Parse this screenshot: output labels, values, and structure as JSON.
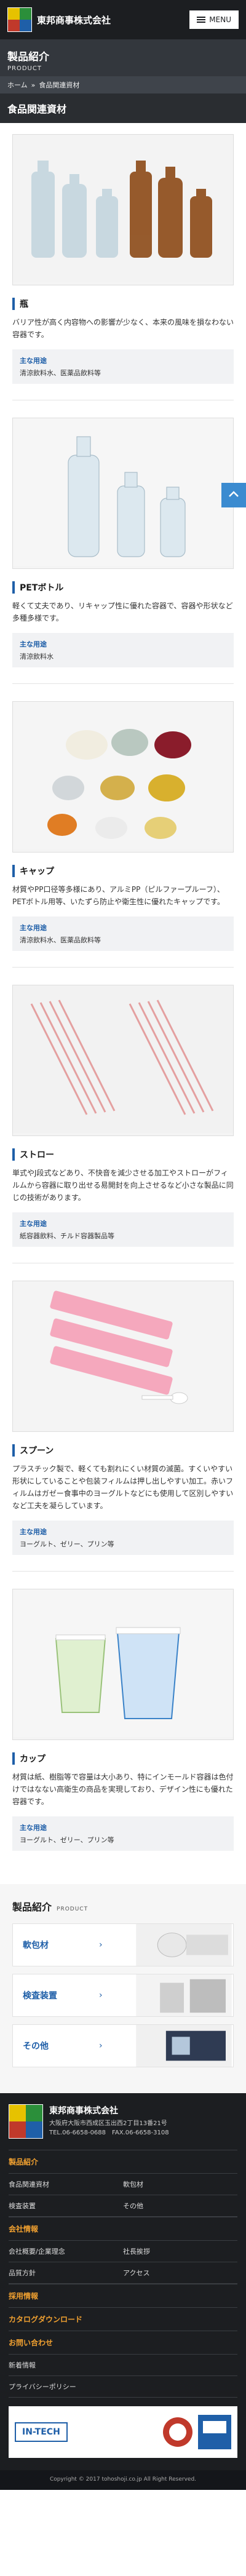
{
  "header": {
    "company_name": "東邦商事株式会社",
    "menu_label": "MENU"
  },
  "page_banner": {
    "title": "製品紹介",
    "subtitle": "PRODUCT"
  },
  "breadcrumb": {
    "home": "ホーム",
    "separator": "»",
    "current": "食品関連資材"
  },
  "section": {
    "title": "食品関連資材"
  },
  "products": [
    {
      "name": "瓶",
      "desc": "バリア性が高く内容物への影響が少なく、本来の風味を損なわない容器です。",
      "uses_label": "主な用途",
      "uses": "清涼飲料水、医薬品飲料等"
    },
    {
      "name": "PETボトル",
      "desc": "軽くて丈夫であり、リキャップ性に優れた容器で、容器や形状など多種多様です。",
      "uses_label": "主な用途",
      "uses": "清涼飲料水"
    },
    {
      "name": "キャップ",
      "desc": "材質やPP口径等多様にあり、アルミPP（ピルファープルーフ）、PETボトル用等、いたずら防止や衛生性に優れたキャップです。",
      "uses_label": "主な用途",
      "uses": "清涼飲料水、医薬品飲料等"
    },
    {
      "name": "ストロー",
      "desc": "単式やJ段式などあり、不快音を減少させる加工やストローがフィルムから容器に取り出せる易開封を向上させるなど小さな製品に同じの技術があります。",
      "uses_label": "主な用途",
      "uses": "紙容器飲料、チルド容器製品等"
    },
    {
      "name": "スプーン",
      "desc": "プラスチック製で、軽くても割れにくい材質の滅菌。すくいやすい形状にしていることや包装フィルムは押し出しやすい加工。赤いフィルムはガゼー食事中のヨーグルトなどにも使用して区別しやすいなど工夫を凝らしています。",
      "uses_label": "主な用途",
      "uses": "ヨーグルト、ゼリー、プリン等"
    },
    {
      "name": "カップ",
      "desc": "材質は紙、樹脂等で容量は大小あり、特にインモールド容器は色付けではなない高衛生の商品を実現しており、デザイン性にも優れた容器です。",
      "uses_label": "主な用途",
      "uses": "ヨーグルト、ゼリー、プリン等"
    }
  ],
  "intro": {
    "title": "製品紹介",
    "subtitle": "PRODUCT",
    "cards": [
      {
        "label": "軟包材"
      },
      {
        "label": "検査装置"
      },
      {
        "label": "その他"
      }
    ]
  },
  "footer": {
    "company": "東邦商事株式会社",
    "address": "大阪府大阪市西成区玉出西2丁目13番21号",
    "tel": "TEL.06-6658-0688　FAX.06-6658-3108",
    "products_head": "製品紹介",
    "products_links": [
      "食品関連資材",
      "軟包材",
      "検査装置",
      "その他"
    ],
    "company_head": "会社情報",
    "company_links": [
      "会社概要/企業理念",
      "社長挨拶",
      "品質方針",
      "アクセス"
    ],
    "recruit": "採用情報",
    "catalog": "カタログダウンロード",
    "contact": "お問い合わせ",
    "news": "新着情報",
    "privacy": "プライバシーポリシー",
    "cert_logo_text": "IN-TECH",
    "copyright": "Copyright © 2017 tohoshoji.co.jp All Right Reserved."
  }
}
